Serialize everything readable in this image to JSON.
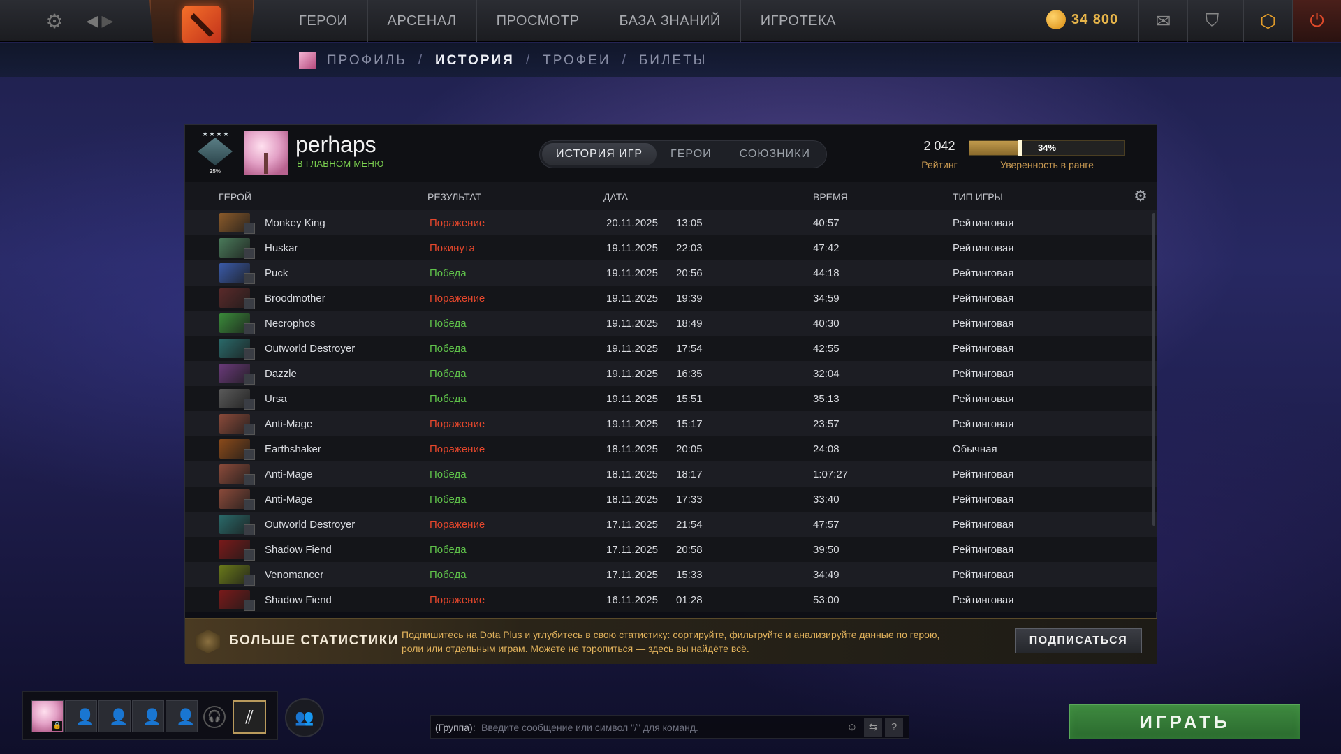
{
  "topbar": {
    "nav": [
      "ГЕРОИ",
      "АРСЕНАЛ",
      "ПРОСМОТР",
      "БАЗА ЗНАНИЙ",
      "ИГРОТЕКА"
    ],
    "gold": "34 800",
    "icons": [
      "gear-icon",
      "back-icon",
      "forward-icon",
      "dota-logo",
      "gold-icon",
      "mail-icon",
      "armory-icon",
      "dota-plus-icon",
      "power-icon"
    ]
  },
  "subnav": {
    "items": [
      "ПРОФИЛЬ",
      "ИСТОРИЯ",
      "ТРОФЕИ",
      "БИЛЕТЫ"
    ],
    "active_index": 1,
    "separator": "/"
  },
  "profile": {
    "name": "perhaps",
    "status": "В ГЛАВНОМ МЕНЮ",
    "medal_percent": "25%",
    "medal_stars": "★★★★"
  },
  "tabs": [
    "ИСТОРИЯ ИГР",
    "ГЕРОИ",
    "СОЮЗНИКИ"
  ],
  "rating": {
    "value": "2 042",
    "label": "Рейтинг"
  },
  "confidence": {
    "value": 0.34,
    "text": "34%",
    "label": "Уверенность в ранге"
  },
  "table": {
    "headers": {
      "hero": "ГЕРОЙ",
      "result": "РЕЗУЛЬТАТ",
      "date": "ДАТА",
      "duration": "ВРЕМЯ",
      "type": "ТИП ИГРЫ"
    },
    "rows": [
      {
        "hero": "Monkey King",
        "result": "Поражение",
        "kind": "loss",
        "date": "20.11.2025",
        "time": "13:05",
        "duration": "40:57",
        "type": "Рейтинговая",
        "color": "#8a5a2a"
      },
      {
        "hero": "Huskar",
        "result": "Покинута",
        "kind": "abandon",
        "date": "19.11.2025",
        "time": "22:03",
        "duration": "47:42",
        "type": "Рейтинговая",
        "color": "#4a7a5a"
      },
      {
        "hero": "Puck",
        "result": "Победа",
        "kind": "win",
        "date": "19.11.2025",
        "time": "20:56",
        "duration": "44:18",
        "type": "Рейтинговая",
        "color": "#3a5aa8"
      },
      {
        "hero": "Broodmother",
        "result": "Поражение",
        "kind": "loss",
        "date": "19.11.2025",
        "time": "19:39",
        "duration": "34:59",
        "type": "Рейтинговая",
        "color": "#5a2a2a"
      },
      {
        "hero": "Necrophos",
        "result": "Победа",
        "kind": "win",
        "date": "19.11.2025",
        "time": "18:49",
        "duration": "40:30",
        "type": "Рейтинговая",
        "color": "#3a8a3a"
      },
      {
        "hero": "Outworld Destroyer",
        "result": "Победа",
        "kind": "win",
        "date": "19.11.2025",
        "time": "17:54",
        "duration": "42:55",
        "type": "Рейтинговая",
        "color": "#2a6a6a"
      },
      {
        "hero": "Dazzle",
        "result": "Победа",
        "kind": "win",
        "date": "19.11.2025",
        "time": "16:35",
        "duration": "32:04",
        "type": "Рейтинговая",
        "color": "#6a3a7a"
      },
      {
        "hero": "Ursa",
        "result": "Победа",
        "kind": "win",
        "date": "19.11.2025",
        "time": "15:51",
        "duration": "35:13",
        "type": "Рейтинговая",
        "color": "#5a5a5a"
      },
      {
        "hero": "Anti-Mage",
        "result": "Поражение",
        "kind": "loss",
        "date": "19.11.2025",
        "time": "15:17",
        "duration": "23:57",
        "type": "Рейтинговая",
        "color": "#8a4a3a"
      },
      {
        "hero": "Earthshaker",
        "result": "Поражение",
        "kind": "loss",
        "date": "18.11.2025",
        "time": "20:05",
        "duration": "24:08",
        "type": "Обычная",
        "color": "#8a4a1a"
      },
      {
        "hero": "Anti-Mage",
        "result": "Победа",
        "kind": "win",
        "date": "18.11.2025",
        "time": "18:17",
        "duration": "1:07:27",
        "type": "Рейтинговая",
        "color": "#8a4a3a"
      },
      {
        "hero": "Anti-Mage",
        "result": "Победа",
        "kind": "win",
        "date": "18.11.2025",
        "time": "17:33",
        "duration": "33:40",
        "type": "Рейтинговая",
        "color": "#8a4a3a"
      },
      {
        "hero": "Outworld Destroyer",
        "result": "Поражение",
        "kind": "loss",
        "date": "17.11.2025",
        "time": "21:54",
        "duration": "47:57",
        "type": "Рейтинговая",
        "color": "#2a6a6a"
      },
      {
        "hero": "Shadow Fiend",
        "result": "Победа",
        "kind": "win",
        "date": "17.11.2025",
        "time": "20:58",
        "duration": "39:50",
        "type": "Рейтинговая",
        "color": "#7a1a1a"
      },
      {
        "hero": "Venomancer",
        "result": "Победа",
        "kind": "win",
        "date": "17.11.2025",
        "time": "15:33",
        "duration": "34:49",
        "type": "Рейтинговая",
        "color": "#6a7a1a"
      },
      {
        "hero": "Shadow Fiend",
        "result": "Поражение",
        "kind": "loss",
        "date": "16.11.2025",
        "time": "01:28",
        "duration": "53:00",
        "type": "Рейтинговая",
        "color": "#7a1a1a"
      }
    ]
  },
  "promo": {
    "title": "БОЛЬШЕ СТАТИСТИКИ",
    "text": "Подпишитесь на Dota Plus и углубитесь в свою статистику: сортируйте, фильтруйте и анализируйте данные по герою, роли или отдельным играм. Можете не торопиться — здесь вы найдёте всё.",
    "button": "ПОДПИСАТЬСЯ"
  },
  "chat": {
    "channel": "(Группа):",
    "placeholder": "Введите сообщение или символ \"/\" для команд."
  },
  "play_button": "ИГРАТЬ"
}
